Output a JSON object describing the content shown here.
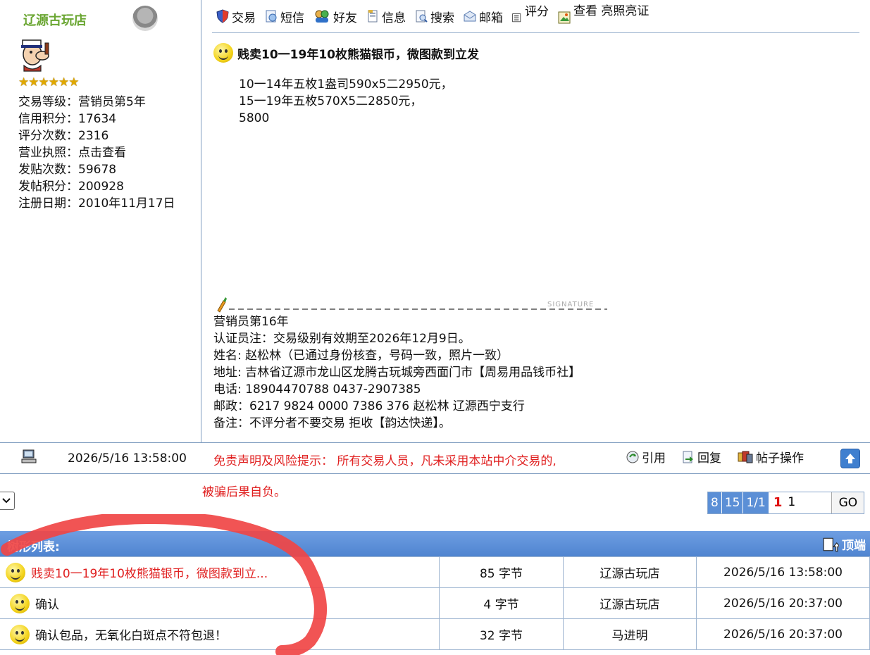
{
  "user": {
    "name": "辽源古玩店",
    "stars": "★★★★★★",
    "info": [
      "交易等级：营销员第5年",
      "信用积分：17634",
      "评分次数：2316",
      "营业执照：点击查看",
      "发贴次数：59678",
      "发帖积分：200928",
      "注册日期：2010年11月17日"
    ]
  },
  "toolbar": {
    "trade": "交易",
    "sms": "短信",
    "friend": "好友",
    "info": "信息",
    "search": "搜索",
    "mail": "邮箱",
    "rate": "评分",
    "view": "查看 亮照亮证"
  },
  "post": {
    "title": "贱卖10一19年10枚熊猫银币，微图款到立发",
    "body": [
      "10一14年五枚1盎司590x5二2950元，",
      "15一19年五枚570X5二2850元，",
      "5800"
    ],
    "signature_label": "SIGNATURE",
    "signature": [
      "营销员第16年",
      "认证员注：交易级别有效期至2026年12月9日。",
      "姓名: 赵松林（已通过身份核查，号码一致，照片一致）",
      "地址: 吉林省辽源市龙山区龙腾古玩城旁西面门市【周易用品钱币社】",
      "电话: 18904470788  0437-2907385",
      "邮政：6217 9824 0000 7386 376 赵松林 辽源西宁支行",
      "备注：不评分者不要交易 拒收【韵达快递】。"
    ],
    "time": "2026/5/16 13:58:00",
    "disclaimer": "免责声明及风险提示： 所有交易人员，凡未采用本站中介交易的,",
    "disclaimer2": "被骗后果自负。"
  },
  "actions": {
    "quote": "引用",
    "reply": "回复",
    "manage": "帖子操作"
  },
  "pager": {
    "p8": "8",
    "p15": "15",
    "total": "1/1",
    "current": "1",
    "input": "1",
    "go": "GO"
  },
  "tree": {
    "title": "树形列表:",
    "top_label": "顶端",
    "rows": [
      {
        "title": "贱卖10一19年10枚熊猫银币，微图款到立...",
        "size": "85 字节",
        "author": "辽源古玩店",
        "time": "2026/5/16 13:58:00"
      },
      {
        "title": "确认",
        "size": "4 字节",
        "author": "辽源古玩店",
        "time": "2026/5/16 20:37:00"
      },
      {
        "title": "确认包品，无氧化白斑点不符包退！",
        "size": "32 字节",
        "author": "马进明",
        "time": "2026/5/16 20:37:00"
      }
    ]
  },
  "colors": {
    "accent": "#5b8fd6",
    "warning": "#e02020",
    "username": "#6aa632"
  }
}
